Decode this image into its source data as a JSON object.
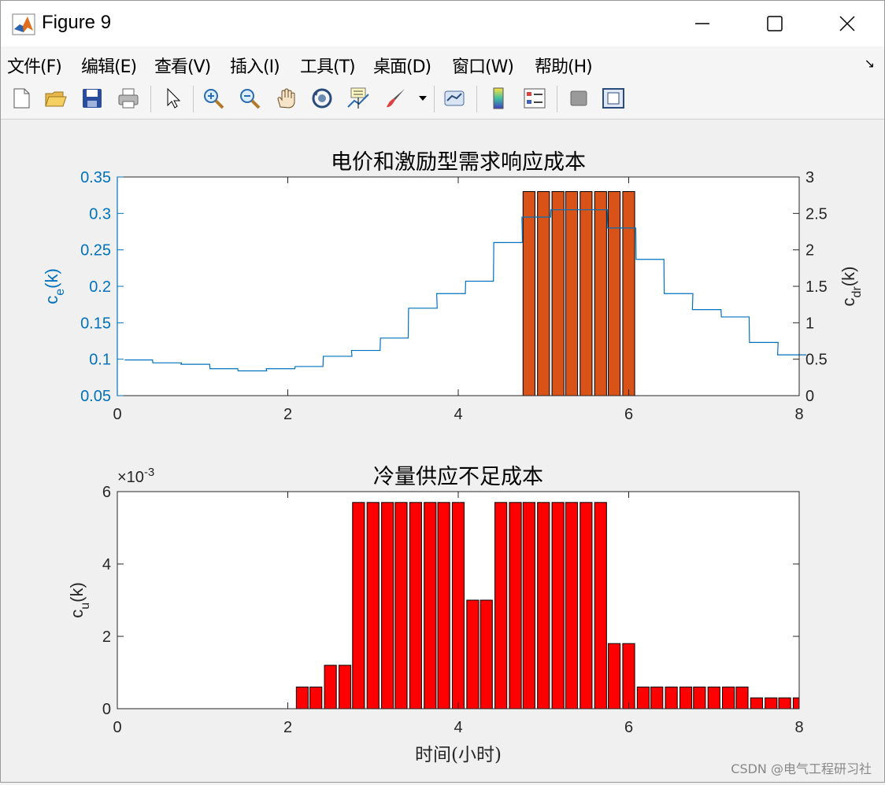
{
  "window": {
    "title": "Figure 9"
  },
  "menu": [
    "文件(F)",
    "编辑(E)",
    "查看(V)",
    "插入(I)",
    "工具(T)",
    "桌面(D)",
    "窗口(W)",
    "帮助(H)"
  ],
  "toolbar": [
    "new-figure-icon",
    "open-file-icon",
    "save-icon",
    "print-icon",
    "pointer-icon",
    "zoom-in-icon",
    "zoom-out-icon",
    "pan-icon",
    "rotate-3d-icon",
    "data-cursor-icon",
    "brush-icon",
    "link-icon",
    "colorbar-icon",
    "legend-icon",
    "hide-plot-tools-icon",
    "show-plot-tools-icon"
  ],
  "colors": {
    "left_axis": "#0072BD",
    "bar_top": "#D95319",
    "bar_bottom": "#FF0000",
    "line": "#0072BD"
  },
  "chart_data": [
    {
      "type": "bar",
      "title": "电价和激励型需求响应成本",
      "xlim": [
        0,
        8
      ],
      "xticks": [
        0,
        2,
        4,
        6,
        8
      ],
      "left_axis": {
        "label_main": "c",
        "label_sub": "e",
        "label_tail": "(k)",
        "ylim": [
          0.05,
          0.35
        ],
        "ticks": [
          "0.05",
          "0.1",
          "0.15",
          "0.2",
          "0.25",
          "0.3",
          "0.35"
        ]
      },
      "right_axis": {
        "label_main": "c",
        "label_sub": "dr",
        "label_tail": "(k)",
        "ylim": [
          0,
          3
        ],
        "ticks": [
          "0",
          "0.5",
          "1",
          "1.5",
          "2",
          "2.5",
          "3"
        ]
      },
      "line_series": {
        "x": [
          0.17,
          0.33,
          0.5,
          0.67,
          0.83,
          1.0,
          1.17,
          1.33,
          1.5,
          1.67,
          1.83,
          2.0,
          2.17,
          2.33,
          2.5,
          2.67,
          2.83,
          3.0,
          3.17,
          3.33,
          3.5,
          3.67,
          3.83,
          4.0,
          4.17,
          4.33,
          4.5,
          4.67,
          4.83,
          5.0,
          5.17,
          5.33,
          5.5,
          5.67,
          5.83,
          6.0,
          6.17,
          6.33,
          6.5,
          6.67,
          6.83,
          7.0,
          7.17,
          7.33,
          7.5,
          7.67,
          7.83,
          8.0
        ],
        "y": [
          0.099,
          0.099,
          0.095,
          0.095,
          0.093,
          0.093,
          0.087,
          0.087,
          0.084,
          0.084,
          0.087,
          0.087,
          0.09,
          0.09,
          0.104,
          0.104,
          0.112,
          0.112,
          0.129,
          0.129,
          0.17,
          0.17,
          0.19,
          0.19,
          0.207,
          0.207,
          0.26,
          0.26,
          0.295,
          0.295,
          0.305,
          0.305,
          0.305,
          0.305,
          0.28,
          0.28,
          0.237,
          0.237,
          0.19,
          0.19,
          0.168,
          0.168,
          0.158,
          0.158,
          0.123,
          0.123,
          0.106,
          0.106
        ]
      },
      "bar_series": {
        "x": [
          4.83,
          5.0,
          5.17,
          5.33,
          5.5,
          5.67,
          5.83,
          6.0
        ],
        "values": [
          2.8,
          2.8,
          2.8,
          2.8,
          2.8,
          2.8,
          2.8,
          2.8
        ],
        "width": 0.14
      }
    },
    {
      "type": "bar",
      "title": "冷量供应不足成本",
      "xlabel": "时间(小时)",
      "ylabel_main": "c",
      "ylabel_sub": "u",
      "ylabel_tail": "(k)",
      "exponent_label": "×10",
      "exponent_power": "-3",
      "xlim": [
        0,
        8
      ],
      "ylim": [
        0,
        6
      ],
      "xticks": [
        0,
        2,
        4,
        6,
        8
      ],
      "yticks": [
        "0",
        "2",
        "4",
        "6"
      ],
      "bar_series": {
        "x": [
          2.17,
          2.33,
          2.5,
          2.67,
          2.83,
          3.0,
          3.17,
          3.33,
          3.5,
          3.67,
          3.83,
          4.0,
          4.17,
          4.33,
          4.5,
          4.67,
          4.83,
          5.0,
          5.17,
          5.33,
          5.5,
          5.67,
          5.83,
          6.0,
          6.17,
          6.33,
          6.5,
          6.67,
          6.83,
          7.0,
          7.17,
          7.33,
          7.5,
          7.67,
          7.83,
          8.0
        ],
        "values": [
          0.6,
          0.6,
          1.2,
          1.2,
          5.7,
          5.7,
          5.7,
          5.7,
          5.7,
          5.7,
          5.7,
          5.7,
          3.0,
          3.0,
          5.7,
          5.7,
          5.7,
          5.7,
          5.7,
          5.7,
          5.7,
          5.7,
          1.8,
          1.8,
          0.6,
          0.6,
          0.6,
          0.6,
          0.6,
          0.6,
          0.6,
          0.6,
          0.3,
          0.3,
          0.3,
          0.3
        ],
        "width": 0.14
      }
    }
  ],
  "watermark": "CSDN @电气工程研习社"
}
